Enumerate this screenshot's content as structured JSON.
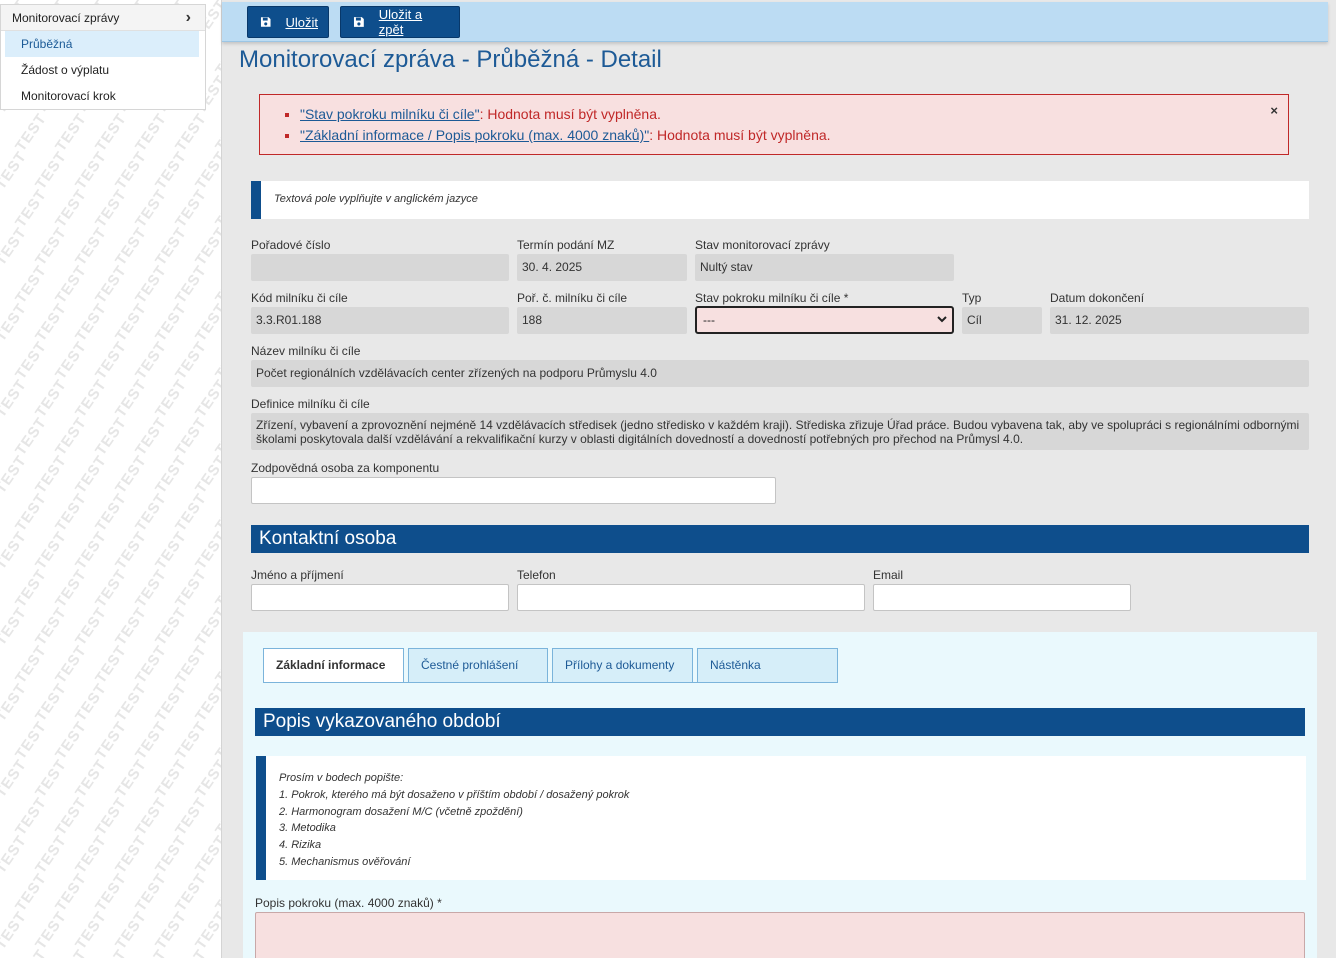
{
  "watermark_text": "TEST",
  "sidebar": {
    "header": "Monitorovací zprávy",
    "items": [
      {
        "label": "Průběžná",
        "active": true
      },
      {
        "label": "Žádost o výplatu",
        "active": false
      },
      {
        "label": "Monitorovací krok",
        "active": false
      }
    ]
  },
  "toolbar": {
    "save_label": "Uložit",
    "save_back_label": "Uložit a zpět"
  },
  "page_title": "Monitorovací zpráva - Průběžná - Detail",
  "errors": [
    {
      "link": "\"Stav pokroku milníku či cíle\"",
      "message": ": Hodnota musí být vyplněna."
    },
    {
      "link": "\"Základní informace / Popis pokroku (max. 4000 znaků)\"",
      "message": ": Hodnota musí být vyplněna."
    }
  ],
  "info_note": "Textová pole vyplňujte v anglickém jazyce",
  "fields": {
    "poradove_cislo": {
      "label": "Pořadové číslo",
      "value": ""
    },
    "termin_podani": {
      "label": "Termín podání MZ",
      "value": "30. 4. 2025"
    },
    "stav_zpravy": {
      "label": "Stav monitorovací zprávy",
      "value": "Nultý stav"
    },
    "kod_milniku": {
      "label": "Kód milníku či cíle",
      "value": "3.3.R01.188"
    },
    "por_c_milniku": {
      "label": "Poř. č. milníku či cíle",
      "value": "188"
    },
    "stav_pokroku": {
      "label": "Stav pokroku milníku či cíle *",
      "value": "---"
    },
    "typ": {
      "label": "Typ",
      "value": "Cíl"
    },
    "datum_dokonceni": {
      "label": "Datum dokončení",
      "value": "31. 12. 2025"
    },
    "nazev_milniku": {
      "label": "Název milníku či cíle",
      "value": "Počet regionálních vzdělávacích center zřízených na podporu Průmyslu 4.0"
    },
    "definice_milniku": {
      "label": "Definice milníku či cíle",
      "value": "Zřízení, vybavení a zprovoznění nejméně 14 vzdělávacích středisek (jedno středisko v každém kraji). Střediska zřizuje Úřad práce. Budou vybavena tak, aby ve spolupráci s regionálními odbornými školami poskytovala další vzdělávání a rekvalifikační kurzy v oblasti digitálních dovedností a dovedností potřebných pro přechod na Průmysl 4.0."
    },
    "zodpovedna_osoba": {
      "label": "Zodpovědná osoba za komponentu",
      "value": ""
    }
  },
  "contact": {
    "heading": "Kontaktní osoba",
    "name_label": "Jméno a příjmení",
    "phone_label": "Telefon",
    "email_label": "Email"
  },
  "tabs": [
    {
      "label": "Základní informace",
      "active": true
    },
    {
      "label": "Čestné prohlášení",
      "active": false
    },
    {
      "label": "Přílohy a dokumenty",
      "active": false
    },
    {
      "label": "Nástěnka",
      "active": false
    }
  ],
  "period_section": {
    "heading": "Popis vykazovaného období",
    "hint_lines": [
      "Prosím v bodech popište:",
      "1. Pokrok, kterého má být dosaženo v příštím období / dosažený pokrok",
      "2. Harmonogram dosažení M/C (včetně zpoždění)",
      "3. Metodika",
      "4. Rizika",
      "5. Mechanismus ověřování"
    ],
    "textarea_label": "Popis pokroku (max. 4000 znaků) *"
  },
  "colors": {
    "primary": "#0e4e8c",
    "toolbar": "#bcdcf3",
    "error": "#c02828",
    "error_bg": "#f8e0e0"
  }
}
